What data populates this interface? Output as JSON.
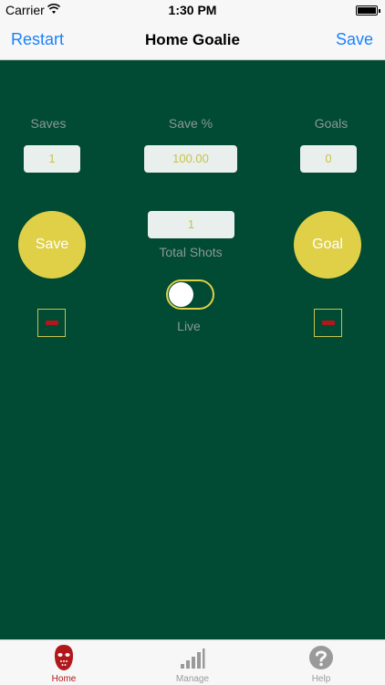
{
  "status_bar": {
    "carrier": "Carrier",
    "time": "1:30 PM"
  },
  "nav": {
    "left_button": "Restart",
    "title": "Home Goalie",
    "right_button": "Save"
  },
  "stats": {
    "saves": {
      "label": "Saves",
      "value": "1"
    },
    "save_pct": {
      "label": "Save %",
      "value": "100.00"
    },
    "goals": {
      "label": "Goals",
      "value": "0"
    },
    "total_shots": {
      "label": "Total Shots",
      "value": "1"
    }
  },
  "buttons": {
    "save": "Save",
    "goal": "Goal"
  },
  "live_toggle": {
    "label": "Live",
    "on": false
  },
  "tabs": [
    {
      "label": "Home",
      "icon": "goalie-mask-icon",
      "active": true
    },
    {
      "label": "Manage",
      "icon": "signal-bars-icon",
      "active": false
    },
    {
      "label": "Help",
      "icon": "question-icon",
      "active": false
    }
  ],
  "colors": {
    "background": "#014a33",
    "accent": "#dfd048",
    "link": "#1a82fb",
    "tab_active": "#b2181b",
    "tab_inactive": "#9a9a9a"
  }
}
